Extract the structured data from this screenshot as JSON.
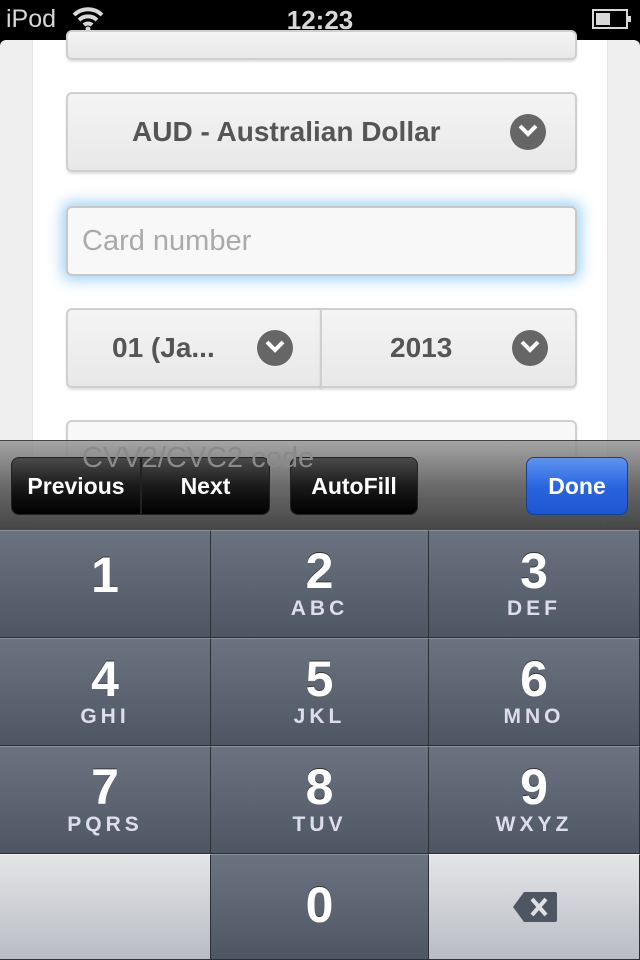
{
  "status": {
    "carrier": "iPod",
    "time": "12:23",
    "battery_level": 0.5
  },
  "form": {
    "currency": "AUD - Australian Dollar",
    "card_placeholder": "Card number",
    "month": "01 (Ja...",
    "year": "2013",
    "cvv_placeholder": "CVV2/CVC2 code"
  },
  "toolbar": {
    "previous": "Previous",
    "next": "Next",
    "autofill": "AutoFill",
    "done": "Done"
  },
  "keypad": [
    {
      "digit": "1",
      "letters": ""
    },
    {
      "digit": "2",
      "letters": "ABC"
    },
    {
      "digit": "3",
      "letters": "DEF"
    },
    {
      "digit": "4",
      "letters": "GHI"
    },
    {
      "digit": "5",
      "letters": "JKL"
    },
    {
      "digit": "6",
      "letters": "MNO"
    },
    {
      "digit": "7",
      "letters": "PQRS"
    },
    {
      "digit": "8",
      "letters": "TUV"
    },
    {
      "digit": "9",
      "letters": "WXYZ"
    },
    {
      "digit": "",
      "letters": ""
    },
    {
      "digit": "0",
      "letters": ""
    },
    {
      "digit": "",
      "letters": "",
      "icon": "backspace-icon"
    }
  ],
  "colors": {
    "done": "#2a66e0",
    "focus_glow": "#78bef0"
  }
}
